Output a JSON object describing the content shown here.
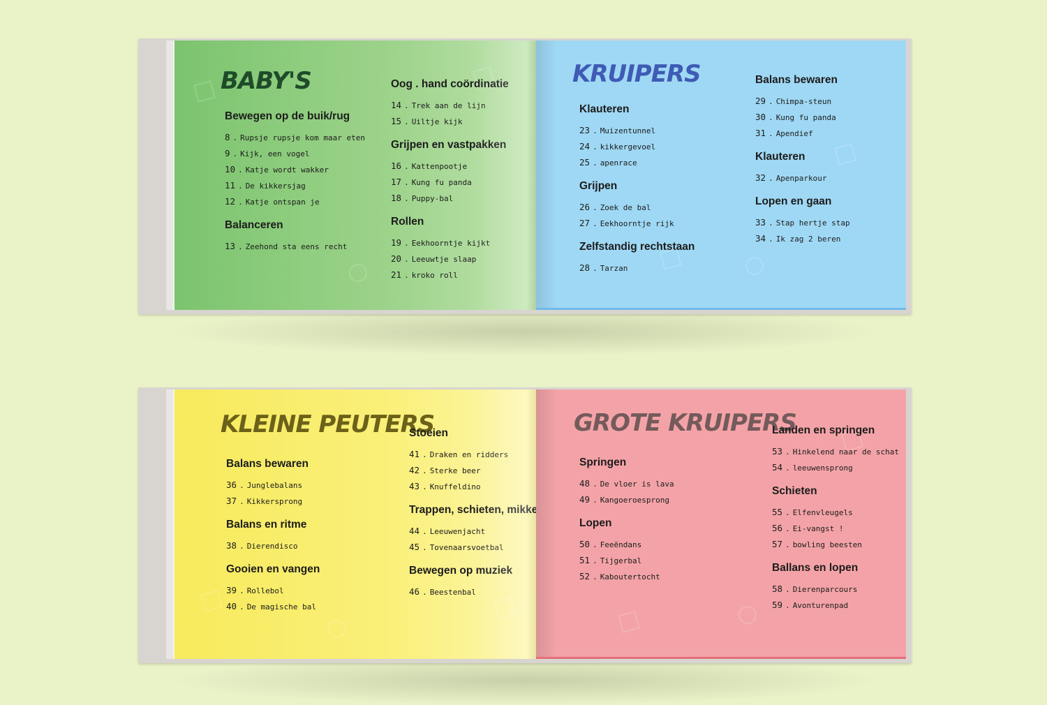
{
  "spreads": [
    {
      "left": {
        "title": "BABY'S",
        "columns": [
          [
            {
              "heading": "Bewegen op de buik/rug",
              "items": [
                {
                  "num": "8",
                  "label": "Rupsje rupsje kom maar eten"
                },
                {
                  "num": "9",
                  "label": "Kijk, een vogel"
                },
                {
                  "num": "10",
                  "label": "Katje wordt wakker"
                },
                {
                  "num": "11",
                  "label": "De kikkersjag"
                },
                {
                  "num": "12",
                  "label": "Katje ontspan je"
                }
              ]
            },
            {
              "heading": "Balanceren",
              "items": [
                {
                  "num": "13",
                  "label": "Zeehond sta eens recht"
                }
              ]
            }
          ],
          [
            {
              "heading": "Oog . hand coördinatie",
              "items": [
                {
                  "num": "14",
                  "label": "Trek aan de lijn"
                },
                {
                  "num": "15",
                  "label": "Uiltje kijk"
                }
              ]
            },
            {
              "heading": "Grijpen en vastpakken",
              "items": [
                {
                  "num": "16",
                  "label": "Kattenpootje"
                },
                {
                  "num": "17",
                  "label": "Kung fu panda"
                },
                {
                  "num": "18",
                  "label": "Puppy-bal"
                }
              ]
            },
            {
              "heading": "Rollen",
              "items": [
                {
                  "num": "19",
                  "label": "Eekhoorntje kijkt"
                },
                {
                  "num": "20",
                  "label": "Leeuwtje slaap"
                },
                {
                  "num": "21",
                  "label": "kroko roll"
                }
              ]
            }
          ]
        ]
      },
      "right": {
        "title": "KRUIPERS",
        "columns": [
          [
            {
              "heading": "Klauteren",
              "items": [
                {
                  "num": "23",
                  "label": "Muizentunnel"
                },
                {
                  "num": "24",
                  "label": "kikkergevoel"
                },
                {
                  "num": "25",
                  "label": "apenrace"
                }
              ]
            },
            {
              "heading": "Grijpen",
              "items": [
                {
                  "num": "26",
                  "label": "Zoek de bal"
                },
                {
                  "num": "27",
                  "label": "Eekhoorntje rijk"
                }
              ]
            },
            {
              "heading": "Zelfstandig rechtstaan",
              "items": [
                {
                  "num": "28",
                  "label": "Tarzan"
                }
              ]
            }
          ],
          [
            {
              "heading": "Balans bewaren",
              "items": [
                {
                  "num": "29",
                  "label": "Chimpa-steun"
                },
                {
                  "num": "30",
                  "label": "Kung fu panda"
                },
                {
                  "num": "31",
                  "label": "Apendief"
                }
              ]
            },
            {
              "heading": "Klauteren",
              "items": [
                {
                  "num": "32",
                  "label": "Apenparkour"
                }
              ]
            },
            {
              "heading": "Lopen en gaan",
              "items": [
                {
                  "num": "33",
                  "label": "Stap hertje stap"
                },
                {
                  "num": "34",
                  "label": "Ik zag 2 beren"
                }
              ]
            }
          ]
        ]
      }
    },
    {
      "left": {
        "title": "KLEINE PEUTERS",
        "columns": [
          [
            {
              "heading": "Balans bewaren",
              "items": [
                {
                  "num": "36",
                  "label": "Junglebalans"
                },
                {
                  "num": "37",
                  "label": "Kikkersprong"
                }
              ]
            },
            {
              "heading": "Balans en ritme",
              "items": [
                {
                  "num": "38",
                  "label": "Dierendisco"
                }
              ]
            },
            {
              "heading": "Gooien en vangen",
              "items": [
                {
                  "num": "39",
                  "label": "Rollebol"
                },
                {
                  "num": "40",
                  "label": "De magische bal"
                }
              ]
            }
          ],
          [
            {
              "heading": "Stoeien",
              "items": [
                {
                  "num": "41",
                  "label": "Draken en ridders"
                },
                {
                  "num": "42",
                  "label": "Sterke beer"
                },
                {
                  "num": "43",
                  "label": "Knuffeldino"
                }
              ]
            },
            {
              "heading": "Trappen, schieten, mikken",
              "items": [
                {
                  "num": "44",
                  "label": "Leeuwenjacht"
                },
                {
                  "num": "45",
                  "label": "Tovenaarsvoetbal"
                }
              ]
            },
            {
              "heading": "Bewegen op muziek",
              "items": [
                {
                  "num": "46",
                  "label": "Beestenbal"
                }
              ]
            }
          ]
        ]
      },
      "right": {
        "title": "GROTE KRUIPERS",
        "columns": [
          [
            {
              "heading": "Springen",
              "items": [
                {
                  "num": "48",
                  "label": "De vloer is lava"
                },
                {
                  "num": "49",
                  "label": "Kangoeroesprong"
                }
              ]
            },
            {
              "heading": "Lopen",
              "items": [
                {
                  "num": "50",
                  "label": "Feeëndans"
                },
                {
                  "num": "51",
                  "label": "Tijgerbal"
                },
                {
                  "num": "52",
                  "label": "Kaboutertocht"
                }
              ]
            }
          ],
          [
            {
              "heading": "Landen en springen",
              "items": [
                {
                  "num": "53",
                  "label": "Hinkelend naar de schat"
                },
                {
                  "num": "54",
                  "label": "leeuwensprong"
                }
              ]
            },
            {
              "heading": "Schieten",
              "items": [
                {
                  "num": "55",
                  "label": "Elfenvleugels"
                },
                {
                  "num": "56",
                  "label": "Ei-vangst !"
                },
                {
                  "num": "57",
                  "label": "bowling beesten"
                }
              ]
            },
            {
              "heading": "Ballans en lopen",
              "items": [
                {
                  "num": "58",
                  "label": "Dierenparcours"
                },
                {
                  "num": "59",
                  "label": "Avonturenpad"
                }
              ]
            }
          ]
        ]
      }
    }
  ],
  "colors": {
    "background": "#eaf2c8",
    "green_page": "#8ccb7b",
    "blue_page": "#9fd8f4",
    "yellow_page": "#f9ee6c",
    "pink_page": "#f3a3a7"
  }
}
